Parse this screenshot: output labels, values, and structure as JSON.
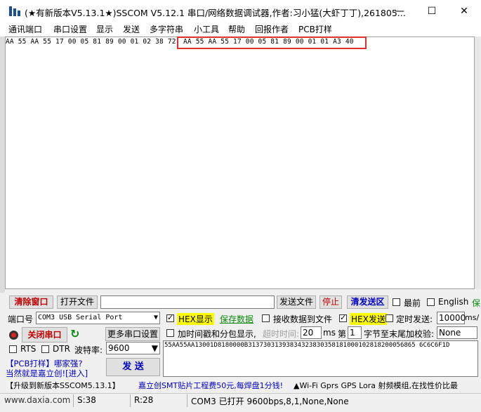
{
  "window": {
    "title": "(★有新版本V5.13.1★)SSCOM V5.12.1 串口/网络数据调试器,作者:习小猛(大虾丁丁),261805...",
    "minimize_label": "—",
    "maximize_label": "☐",
    "close_label": "✕"
  },
  "menu": [
    "通讯端口",
    "串口设置",
    "显示",
    "发送",
    "多字符串",
    "小工具",
    "帮助",
    "回报作者",
    "PCB打样"
  ],
  "receive": {
    "text": "AA 55 AA 55 17 00 05 81 89 00 01 02 38 72",
    "highlighted_text": "AA 55 AA 55 17 00 05 81 89 00 01 01 A3 40"
  },
  "row1": {
    "clear_window": "清除窗口",
    "open_file": "打开文件",
    "file_path": "",
    "send_file": "发送文件",
    "stop": "停止",
    "clear_send": "清发送区",
    "last_label": "最前",
    "english_label": "English"
  },
  "port": {
    "port_label": "端口号",
    "port_value": "COM3 USB Serial Port",
    "close_port": "关闭串口",
    "more_settings": "更多串口设置",
    "rts_label": "RTS",
    "dtr_label": "DTR",
    "baud_label": "波特率:",
    "baud_value": "9600"
  },
  "options": {
    "hex_display": "HEX显示",
    "save_data": "保存数据",
    "recv_to_file": "接收数据到文件",
    "hex_send": "HEX发送",
    "timed_send": "定时发送:",
    "timed_value": "10000",
    "timed_unit": "ms/",
    "add_timestamp": "加时间戳和分包显示,",
    "timeout_label": "超时时间:",
    "timeout_value": "20",
    "timeout_unit": "ms",
    "nth_label": "第",
    "nth_value": "1",
    "checksum_label": "字节至末尾加校验:",
    "checksum_value": "None"
  },
  "send": {
    "send_text": "55AA55AA13001D8180000B31373031393834323830358181000102818200056865 6C6C6F1D",
    "send_button": "发  送",
    "promo_line1": "【PCB打样】哪家强?",
    "promo_line2": "当然就是嘉立创![进入]"
  },
  "marquee": {
    "upgrade": "【升级到新版本SSCOM5.13.1】",
    "ad1": "嘉立创SMT贴片工程费50元,每焊盘1分钱!",
    "ad2": "▲Wi-Fi Gprs GPS Lora 射频模组,在找性价比最"
  },
  "status": {
    "website": "www.daxia.com",
    "sent": "S:38",
    "received": "R:28",
    "port_state": "COM3 已打开  9600bps,8,1,None,None"
  }
}
